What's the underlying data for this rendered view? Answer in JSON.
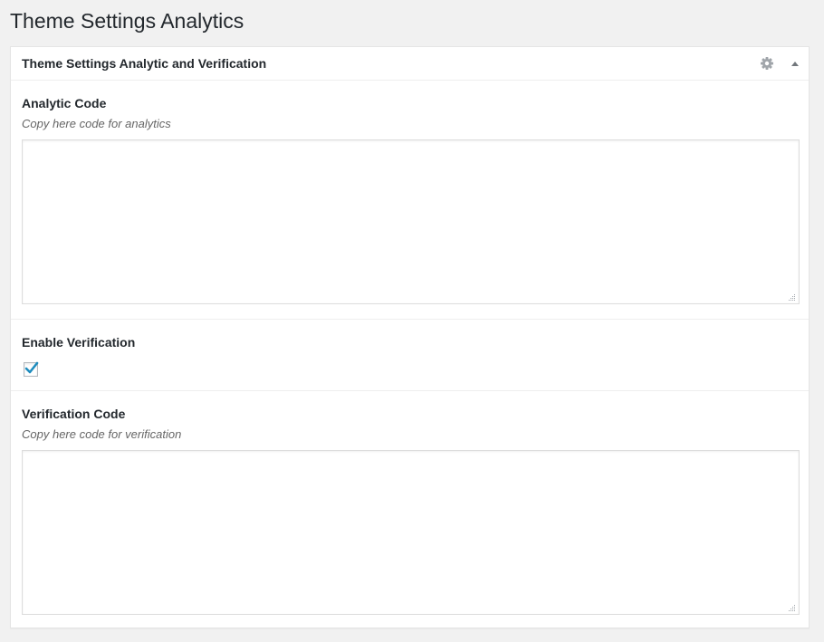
{
  "page": {
    "title": "Theme Settings Analytics"
  },
  "postbox": {
    "title": "Theme Settings Analytic and Verification",
    "icons": {
      "settings": "gear-icon",
      "toggle": "triangle-up-icon"
    }
  },
  "fields": {
    "analytic": {
      "label": "Analytic Code",
      "description": "Copy here code for analytics",
      "value": ""
    },
    "enable_verification": {
      "label": "Enable Verification",
      "checked": true
    },
    "verification": {
      "label": "Verification Code",
      "description": "Copy here code for verification",
      "value": ""
    }
  },
  "colors": {
    "background": "#f1f1f1",
    "checkmark": "#1e8cbe",
    "icon": "#a0a5aa"
  }
}
